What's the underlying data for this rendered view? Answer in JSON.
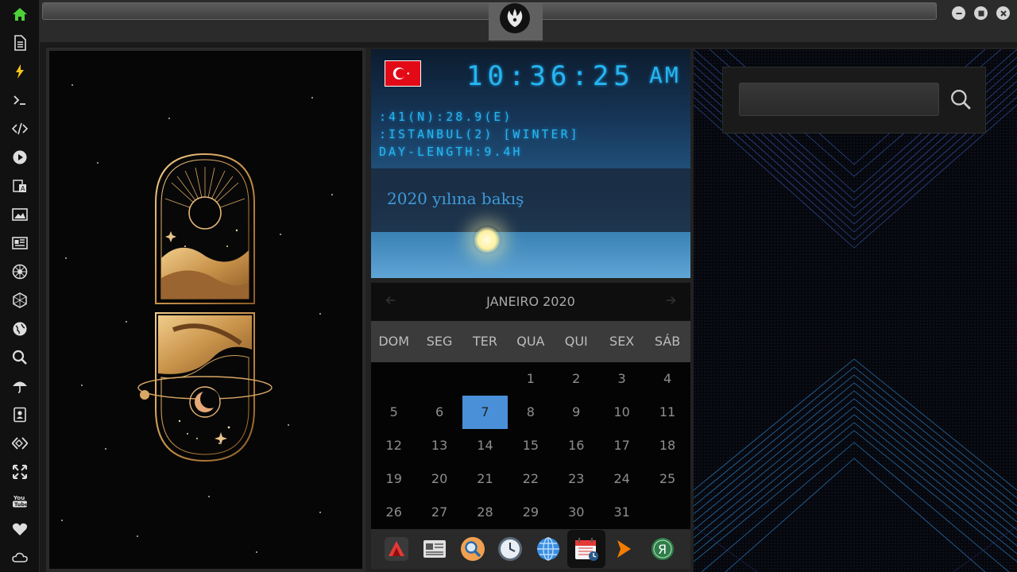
{
  "window": {
    "address_value": "",
    "controls": [
      "minimize",
      "maximize",
      "close"
    ]
  },
  "sidebar": {
    "items": [
      {
        "name": "home-icon",
        "color": "#4cd137"
      },
      {
        "name": "document-icon"
      },
      {
        "name": "lightning-icon",
        "color": "#f5c518"
      },
      {
        "name": "terminal-icon"
      },
      {
        "name": "code-icon"
      },
      {
        "name": "play-icon"
      },
      {
        "name": "translate-icon"
      },
      {
        "name": "image-icon"
      },
      {
        "name": "news-icon"
      },
      {
        "name": "emblem-icon"
      },
      {
        "name": "hexagon-icon"
      },
      {
        "name": "globe-icon"
      },
      {
        "name": "search-icon"
      },
      {
        "name": "umbrella-icon"
      },
      {
        "name": "contacts-icon"
      },
      {
        "name": "diamond-code-icon"
      },
      {
        "name": "expand-icon"
      },
      {
        "name": "youtube-icon"
      },
      {
        "name": "heart-icon"
      },
      {
        "name": "cloud-icon"
      }
    ]
  },
  "weather": {
    "time": "10:36:25",
    "ampm": "AM",
    "coords": ":41(N):28.9(E)",
    "location": ":ISTANBUL(2) [WINTER]",
    "day_length": "DAY-LENGTH:9.4H",
    "banner": "2020 yılına bakış",
    "flag": "turkey-flag-icon"
  },
  "calendar": {
    "title": "JANEIRO 2020",
    "days": [
      "DOM",
      "SEG",
      "TER",
      "QUA",
      "QUI",
      "SEX",
      "SÁB"
    ],
    "weeks": [
      [
        "",
        "",
        "",
        "1",
        "2",
        "3",
        "4"
      ],
      [
        "5",
        "6",
        "7",
        "8",
        "9",
        "10",
        "11"
      ],
      [
        "12",
        "13",
        "14",
        "15",
        "16",
        "17",
        "18"
      ],
      [
        "19",
        "20",
        "21",
        "22",
        "23",
        "24",
        "25"
      ],
      [
        "26",
        "27",
        "28",
        "29",
        "30",
        "31",
        ""
      ]
    ],
    "selected": "7",
    "selected_color": "#4a90d9"
  },
  "dock": {
    "items": [
      {
        "name": "app-launcher-icon"
      },
      {
        "name": "news-reader-icon"
      },
      {
        "name": "search-app-icon"
      },
      {
        "name": "clock-app-icon"
      },
      {
        "name": "browser-globe-icon"
      },
      {
        "name": "calendar-app-icon",
        "active": true
      },
      {
        "name": "terminal-arrow-icon"
      },
      {
        "name": "yandex-icon"
      }
    ]
  },
  "search": {
    "value": "",
    "placeholder": ""
  }
}
